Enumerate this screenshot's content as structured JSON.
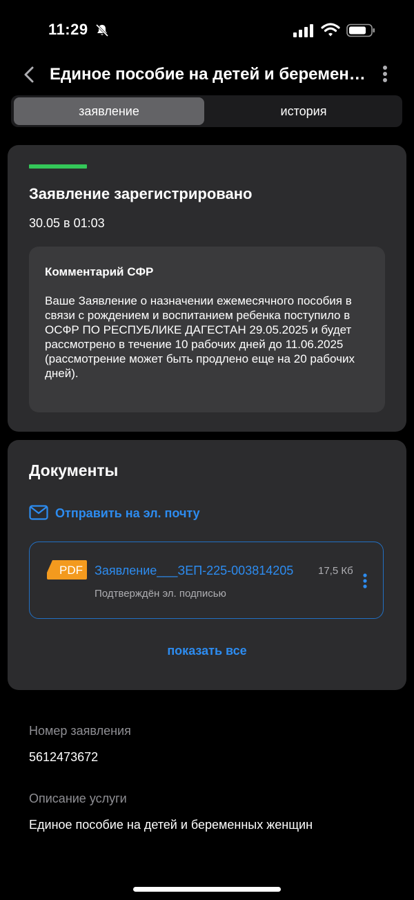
{
  "status_bar": {
    "time": "11:29"
  },
  "header": {
    "title": "Единое пособие на детей и беременных женщин"
  },
  "tabs": [
    {
      "label": "заявление",
      "active": true
    },
    {
      "label": "история",
      "active": false
    }
  ],
  "status_card": {
    "title": "Заявление зарегистрировано",
    "date": "30.05 в 01:03",
    "progress_color": "#34c759",
    "comment": {
      "title": "Комментарий СФР",
      "text": "Ваше Заявление о назначении ежемесячного пособия в связи с рождением и воспитанием ребенка поступило в ОСФР ПО РЕСПУБЛИКЕ ДАГЕСТАН 29.05.2025 и будет рассмотрено в течение 10 рабочих дней до 11.06.2025 (рассмотрение может быть продлено еще на 20 рабочих дней)."
    }
  },
  "documents": {
    "title": "Документы",
    "send_email_label": "Отправить на эл. почту",
    "items": [
      {
        "badge": "PDF",
        "name": "Заявление___ЗЕП-225-003814205",
        "size": "17,5 Кб",
        "subtitle": "Подтверждён эл. подписью"
      }
    ],
    "show_all_label": "показать все"
  },
  "details": {
    "number_label": "Номер заявления",
    "number_value": "5612473672",
    "description_label": "Описание услуги",
    "description_value": "Единое пособие на детей и беременных женщин"
  },
  "colors": {
    "accent": "#2d8cf0",
    "pdf_badge": "#f39a1e",
    "success": "#34c759"
  }
}
